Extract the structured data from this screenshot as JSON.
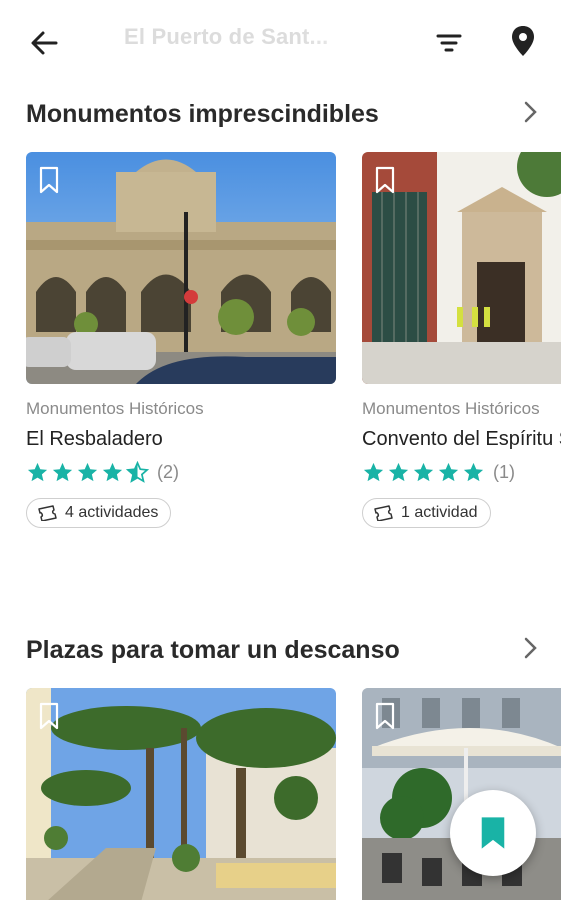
{
  "header": {
    "title": "El Puerto de Sant... ",
    "icons": {
      "back": "arrow-left-icon",
      "filter": "filter-icon",
      "location": "map-pin-icon"
    }
  },
  "colors": {
    "accent": "#19b3a6",
    "star": "#19b3a6",
    "title_faded": "#dcdcdc"
  },
  "sections": [
    {
      "title": "Monumentos imprescindibles",
      "cards": [
        {
          "category": "Monumentos Históricos",
          "name": "El Resbaladero",
          "rating": 4.5,
          "rating_count": "(2)",
          "activities": "4 actividades"
        },
        {
          "category": "Monumentos Históricos",
          "name": "Convento del Espíritu Santo",
          "rating": 5,
          "rating_count": "(1)",
          "activities": "1 actividad"
        }
      ]
    },
    {
      "title": "Plazas para tomar un descanso",
      "cards": []
    }
  ]
}
